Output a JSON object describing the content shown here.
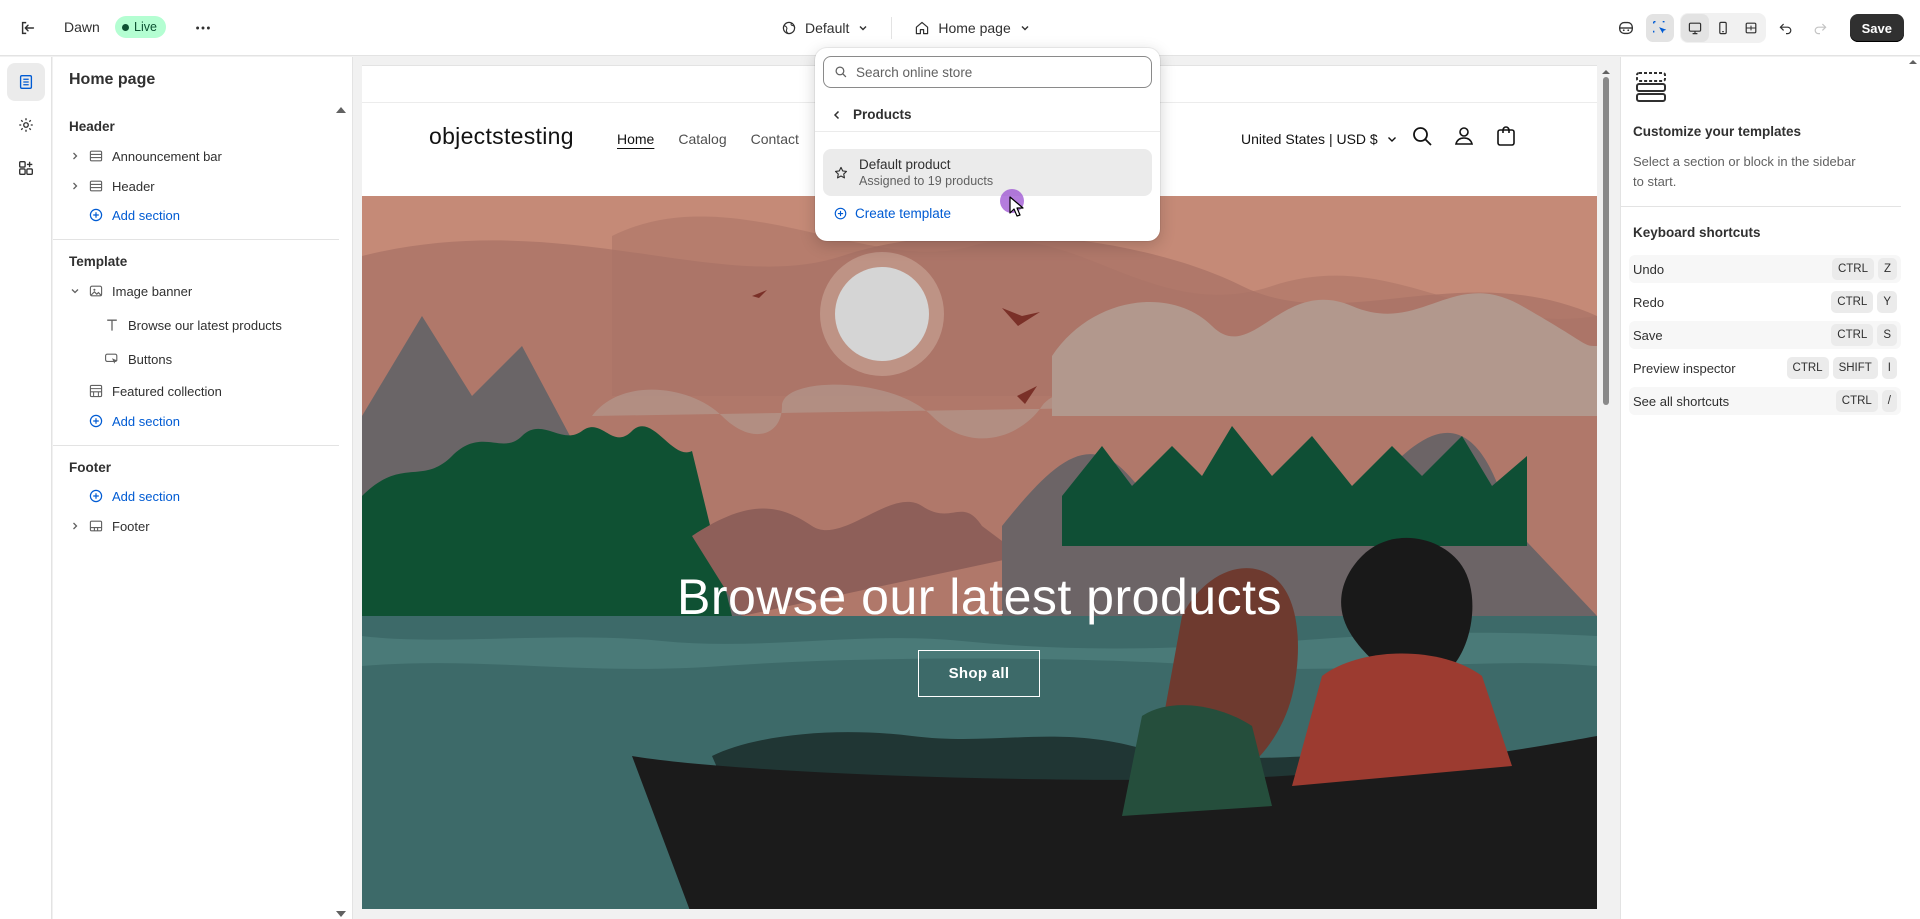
{
  "topbar": {
    "theme_name": "Dawn",
    "live_badge": "Live",
    "theme_context": "Default",
    "page_context": "Home page",
    "save_label": "Save"
  },
  "sidebar": {
    "title": "Home page",
    "header_group": "Header",
    "header_items": [
      "Announcement bar",
      "Header"
    ],
    "add_section": "Add section",
    "template_group": "Template",
    "template_items": {
      "image_banner": "Image banner",
      "browse_text": "Browse our latest products",
      "buttons": "Buttons",
      "featured_collection": "Featured collection"
    },
    "footer_group": "Footer",
    "footer_items": [
      "Footer"
    ]
  },
  "store": {
    "logo": "objectstesting",
    "nav": [
      "Home",
      "Catalog",
      "Contact"
    ],
    "locale": "United States | USD $",
    "hero_title": "Browse our latest products",
    "hero_button": "Shop all"
  },
  "dropdown": {
    "search_placeholder": "Search online store",
    "back_label": "Products",
    "option_title": "Default product",
    "option_subtitle": "Assigned to 19 products",
    "create_label": "Create template"
  },
  "right_panel": {
    "title": "Customize your templates",
    "description": "Select a section or block in the sidebar to start.",
    "shortcuts_title": "Keyboard shortcuts",
    "shortcuts": [
      {
        "label": "Undo",
        "keys": [
          "CTRL",
          "Z"
        ]
      },
      {
        "label": "Redo",
        "keys": [
          "CTRL",
          "Y"
        ]
      },
      {
        "label": "Save",
        "keys": [
          "CTRL",
          "S"
        ]
      },
      {
        "label": "Preview inspector",
        "keys": [
          "CTRL",
          "SHIFT",
          "I"
        ]
      },
      {
        "label": "See all shortcuts",
        "keys": [
          "CTRL",
          "/"
        ]
      }
    ]
  },
  "colors": {
    "accent_blue": "#005bd3",
    "live_badge_bg": "#b4fed2",
    "save_button_bg": "#303030"
  }
}
